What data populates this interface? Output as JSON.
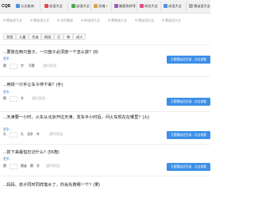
{
  "header": {
    "logo": "CQB",
    "nav": [
      {
        "label": "公文查询",
        "icon": "doc-icon",
        "color": "#4a90e2"
      },
      {
        "label": "成语大全",
        "icon": "book-icon",
        "color": "#e24a4a"
      },
      {
        "label": "谜语大全",
        "icon": "puzzle-icon",
        "color": "#4aa84a"
      },
      {
        "label": "灵魂",
        "icon": "star-icon",
        "color": "#e2a04a"
      },
      {
        "label": "脑筋急转弯",
        "icon": "brain-icon",
        "color": "#9b59b6"
      },
      {
        "label": "网名大全",
        "icon": "user-icon",
        "color": "#e24a8a"
      },
      {
        "label": "成语大全",
        "icon": "book-icon",
        "color": "#4a90e2"
      }
    ]
  },
  "subnav": [
    "猜谜语大全",
    "猜谜语大全",
    "全民猜谜",
    "新谜语大全",
    "猜物谜大全",
    "猜谜语大全",
    "猜谜语大全"
  ],
  "filters": [
    "答案",
    "儿童",
    "字谜",
    "搞笑",
    "灯",
    "物",
    "成人"
  ],
  "questions": [
    {
      "title": "...要放在两只盘子，一只盘子必须放一个怎么放？(8)",
      "more": "更多...",
      "options": [
        "猜",
        "字",
        "写猜"
      ],
      "hint": "[猜问项目]",
      "button": "万题猜谜总目录 - 点击查看"
    },
    {
      "title": "...用铁一只手让车子停下来？(手)",
      "more": "更多...",
      "options": [
        "猜",
        "字"
      ],
      "hint": "[猜问项目]",
      "button": "万题猜谜总目录 - 点击查看"
    },
    {
      "title": "...天津要一小时，火车从北京开往天津，发车半小时后，问火车现在在哪里？(火)",
      "more": "更多...",
      "options": [
        "天",
        "天",
        "北京",
        "车"
      ],
      "hint": "[猜问项目]",
      "button": "万题猜谜总目录 - 点击查看"
    },
    {
      "title": "...抓下来最怕忘记什么？(55角)",
      "more": "更多...",
      "options": [
        "猜",
        "猜谜",
        "猜",
        "字"
      ],
      "hint": "[猜问项目]",
      "button": "万题猜谜总目录 - 点击查看"
    },
    {
      "title": "...妈妈、孩子同时同样落水了，你会先救哪一个？(果)",
      "more": "",
      "options": [],
      "hint": "",
      "button": ""
    }
  ]
}
